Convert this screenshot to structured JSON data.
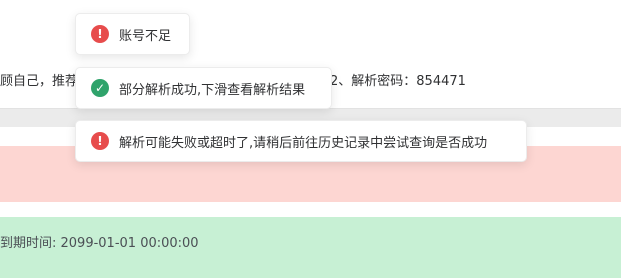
{
  "background": {
    "notice_left": "顾自己，推荐",
    "notice_right": "2、解析密码：854471",
    "expire_text": "到期时间: 2099-01-01 00:00:00"
  },
  "colors": {
    "error": "#e74c4c",
    "success": "#2fa36b",
    "error_band": "#fdd6d2",
    "success_band": "#c7f0d4"
  },
  "toasts": [
    {
      "type": "error",
      "icon": "!",
      "text": "账号不足"
    },
    {
      "type": "success",
      "icon": "✓",
      "text": "部分解析成功,下滑查看解析结果"
    },
    {
      "type": "error",
      "icon": "!",
      "text": "解析可能失败或超时了,请稍后前往历史记录中尝试查询是否成功"
    }
  ]
}
